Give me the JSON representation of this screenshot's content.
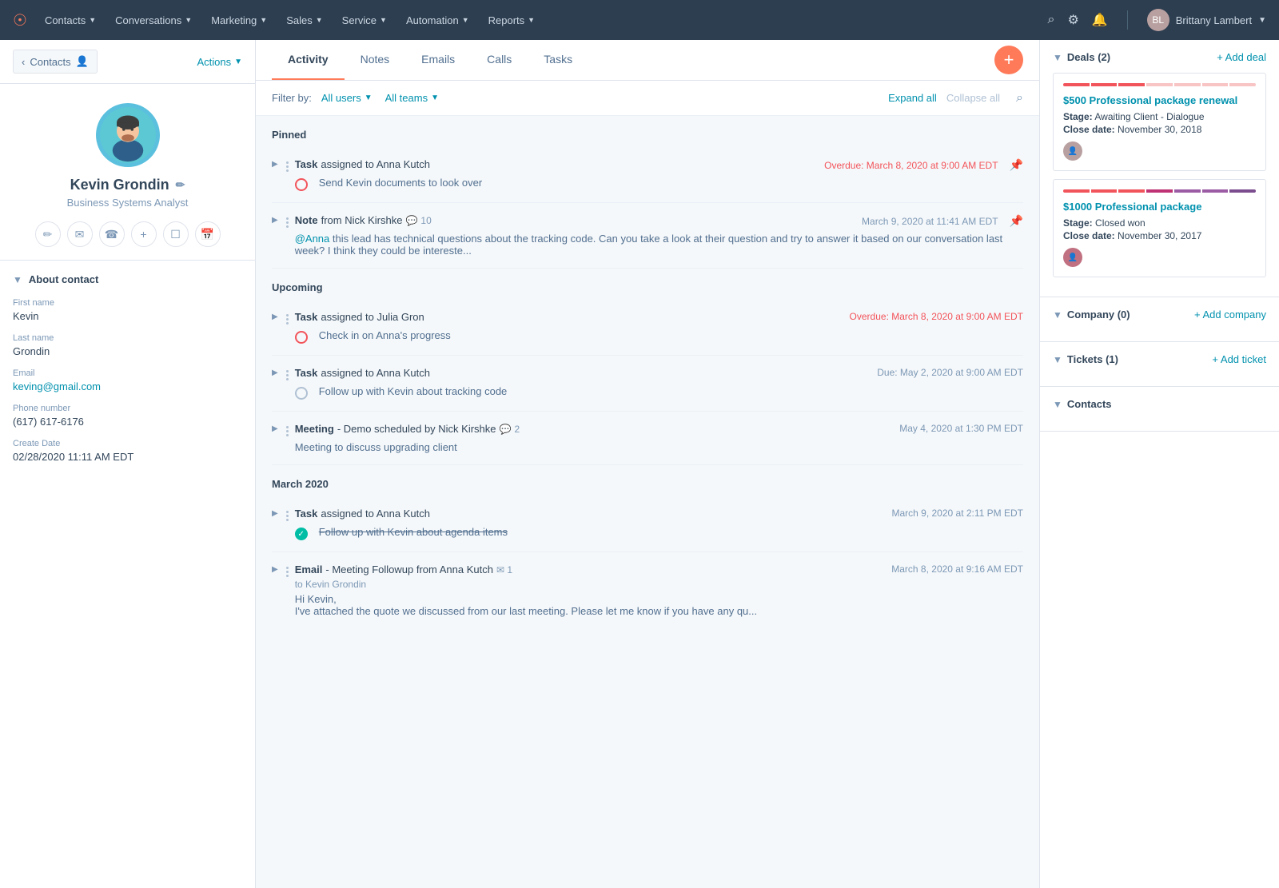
{
  "nav": {
    "logo": "🔶",
    "items": [
      "Contacts",
      "Conversations",
      "Marketing",
      "Sales",
      "Service",
      "Automation",
      "Reports"
    ],
    "user": "Brittany Lambert"
  },
  "sidebar": {
    "back_label": "Contacts",
    "actions_label": "Actions",
    "contact": {
      "name": "Kevin Grondin",
      "title": "Business Systems Analyst",
      "about_label": "About contact",
      "fields": [
        {
          "label": "First name",
          "value": "Kevin",
          "link": false
        },
        {
          "label": "Last name",
          "value": "Grondin",
          "link": false
        },
        {
          "label": "Email",
          "value": "keving@gmail.com",
          "link": true
        },
        {
          "label": "Phone number",
          "value": "(617) 617-6176",
          "link": false
        },
        {
          "label": "Create Date",
          "value": "02/28/2020 11:11 AM EDT",
          "link": false
        }
      ]
    }
  },
  "tabs": {
    "items": [
      "Activity",
      "Notes",
      "Emails",
      "Calls",
      "Tasks"
    ],
    "active": "Activity"
  },
  "filter": {
    "label": "Filter by:",
    "users_label": "All users",
    "teams_label": "All teams",
    "expand_label": "Expand all",
    "collapse_label": "Collapse all"
  },
  "sections": [
    {
      "title": "Pinned",
      "items": [
        {
          "type": "task",
          "title_bold": "Task",
          "title_rest": "assigned to Anna Kutch",
          "body": "Send Kevin documents to look over",
          "time": "Overdue: March 8, 2020 at 9:00 AM EDT",
          "overdue": true,
          "status": "overdue",
          "pinned": true
        },
        {
          "type": "note",
          "title_bold": "Note",
          "title_rest": "from Nick Kirshke",
          "comment_count": "10",
          "body": "@Anna this lead has technical questions about the tracking code. Can you take a look at their question and try to answer it based on our conversation last week? I think they could be intereste...",
          "time": "March 9, 2020 at 11:41 AM EDT",
          "overdue": false,
          "status": "note",
          "pinned": true
        }
      ]
    },
    {
      "title": "Upcoming",
      "items": [
        {
          "type": "task",
          "title_bold": "Task",
          "title_rest": "assigned to Julia Gron",
          "body": "Check in on Anna's progress",
          "time": "Overdue: March 8, 2020 at 9:00 AM EDT",
          "overdue": true,
          "status": "overdue",
          "pinned": false
        },
        {
          "type": "task",
          "title_bold": "Task",
          "title_rest": "assigned to Anna Kutch",
          "body": "Follow up with Kevin about tracking code",
          "time": "Due: May 2, 2020 at 9:00 AM EDT",
          "overdue": false,
          "status": "pending-gray",
          "pinned": false
        },
        {
          "type": "meeting",
          "title_bold": "Meeting",
          "title_middle": " - Demo",
          "title_rest": "scheduled by Nick Kirshke",
          "comment_count": "2",
          "body": "Meeting to discuss upgrading client",
          "time": "May 4, 2020 at 1:30 PM EDT",
          "overdue": false,
          "status": "meeting",
          "pinned": false
        }
      ]
    },
    {
      "title": "March 2020",
      "items": [
        {
          "type": "task",
          "title_bold": "Task",
          "title_rest": "assigned to Anna Kutch",
          "body": "Follow up with Kevin about agenda items",
          "time": "March 9, 2020 at 2:11 PM EDT",
          "overdue": false,
          "status": "done",
          "strikethrough": true,
          "pinned": false
        },
        {
          "type": "email",
          "title_bold": "Email",
          "title_middle": " - Meeting Followup",
          "title_rest": "from Anna Kutch",
          "email_count": "1",
          "to_label": "to Kevin Grondin",
          "body": "Hi Kevin,\nI've attached the quote we discussed from our last meeting. Please let me know if you have any qu...",
          "time": "March 8, 2020 at 9:16 AM EDT",
          "overdue": false,
          "status": "email",
          "pinned": false
        }
      ]
    }
  ],
  "right_panel": {
    "deals": {
      "title": "Deals (2)",
      "add_label": "+ Add deal",
      "items": [
        {
          "name": "$500 Professional package renewal",
          "stage_label": "Stage:",
          "stage": "Awaiting Client - Dialogue",
          "close_label": "Close date:",
          "close_date": "November 30, 2018",
          "progress_colors": [
            "#f2545b",
            "#f2545b",
            "#f2545b",
            "#f8c4c4",
            "#f8c4c4",
            "#f8c4c4",
            "#f8c4c4"
          ]
        },
        {
          "name": "$1000 Professional package",
          "stage_label": "Stage:",
          "stage": "Closed won",
          "close_label": "Close date:",
          "close_date": "November 30, 2017",
          "progress_colors": [
            "#f2545b",
            "#f2545b",
            "#f2545b",
            "#bf3274",
            "#9b5ca4",
            "#9b5ca4",
            "#9b5ca4"
          ]
        }
      ]
    },
    "company": {
      "title": "Company (0)",
      "add_label": "+ Add company"
    },
    "tickets": {
      "title": "Tickets (1)",
      "add_label": "+ Add ticket"
    },
    "contacts": {
      "title": "Contacts"
    }
  }
}
